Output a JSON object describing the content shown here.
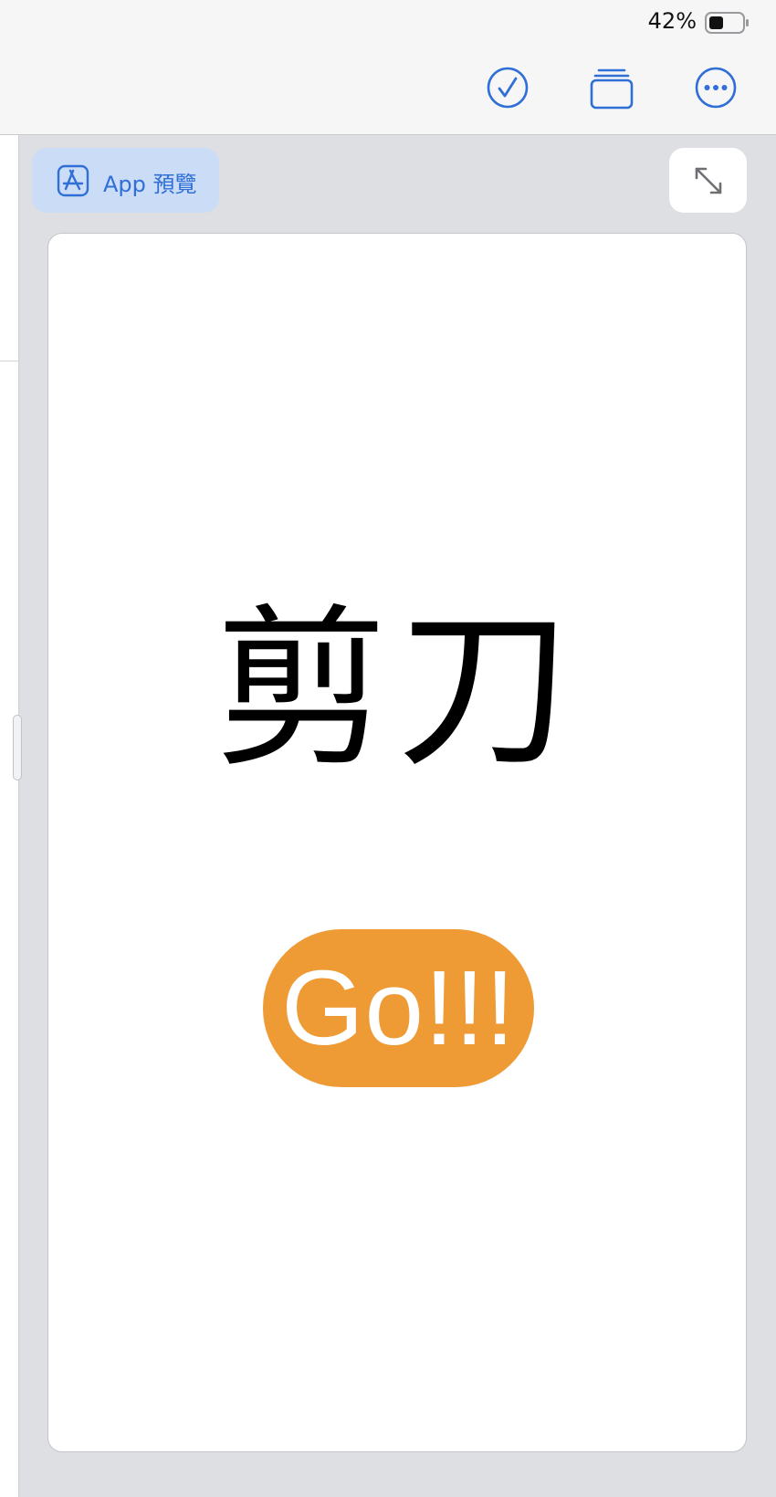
{
  "status": {
    "battery_percent": "42%",
    "battery_level": 0.42
  },
  "toolbar": {
    "done_icon": "checkmark-circle-icon",
    "windows_icon": "stacked-windows-icon",
    "more_icon": "ellipsis-circle-icon",
    "accent_color": "#2f6fd6"
  },
  "preview": {
    "chip_label": "App 預覽",
    "chip_icon": "app-store-icon",
    "expand_icon": "expand-arrows-icon"
  },
  "app": {
    "headline": "剪刀",
    "button_label": "Go!!!",
    "button_color": "#ee9b36"
  }
}
